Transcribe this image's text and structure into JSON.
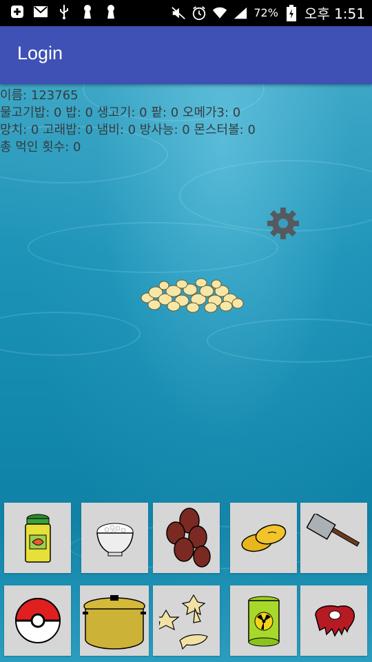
{
  "status_bar": {
    "battery": "72%",
    "time": "오후 1:51",
    "icons": [
      "add-box-icon",
      "mail-icon",
      "usb-icon",
      "keyhole-icon",
      "keyhole-icon",
      "mute-icon",
      "alarm-icon",
      "wifi-icon",
      "signal-icon",
      "battery-icon"
    ]
  },
  "appbar": {
    "title": "Login"
  },
  "info": {
    "line1": "이름: 123765",
    "line2": "물고기밥: 0 밥: 0 생고기: 0 팥: 0 오메가3: 0",
    "line3": "망치: 0 고래밥: 0 냄비: 0 방사능: 0 몬스터볼: 0",
    "line4": "총 먹인 횟수: 0"
  },
  "items": [
    {
      "name": "fish-food-can-icon"
    },
    {
      "name": "rice-bowl-icon"
    },
    {
      "name": "raw-meat-icon"
    },
    {
      "name": "omega3-capsule-icon"
    },
    {
      "name": "hammer-icon"
    },
    {
      "name": "pokeball-icon"
    },
    {
      "name": "pot-icon"
    },
    {
      "name": "whale-snack-icon"
    },
    {
      "name": "radioactive-barrel-icon"
    },
    {
      "name": "monster-meat-icon"
    }
  ],
  "colors": {
    "appbar": "#3f51b5",
    "button_bg": "#d6d6d6",
    "ocean": "#1489ae"
  }
}
